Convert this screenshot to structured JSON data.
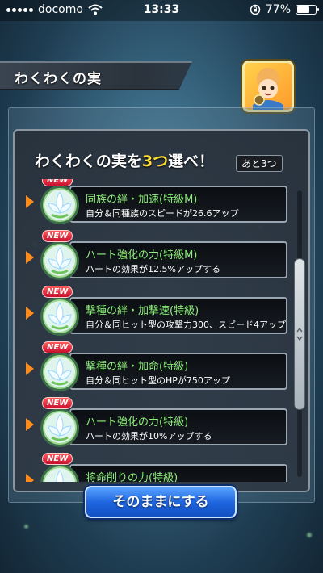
{
  "status_bar": {
    "carrier": "docomo",
    "time": "13:33",
    "battery_percent": "77%",
    "battery_level": 0.77,
    "icons": [
      "signal-icon",
      "wifi-icon",
      "rotation-lock-icon",
      "battery-icon"
    ]
  },
  "header": {
    "title": "わくわくの実"
  },
  "prompt": {
    "text_before": "わくわくの実を",
    "count": "3つ",
    "text_after": "選べ！",
    "remaining": "あと3つ"
  },
  "items": [
    {
      "badge": "NEW",
      "title": "同族の絆・加速(特級M)",
      "description": "自分＆同種族のスピードが26.6アップ"
    },
    {
      "badge": "NEW",
      "title": "ハート強化の力(特級M)",
      "description": "ハートの効果が12.5%アップする"
    },
    {
      "badge": "NEW",
      "title": "撃種の絆・加撃速(特級)",
      "description": "自分＆同ヒット型の攻撃力300、スピード4アップ"
    },
    {
      "badge": "NEW",
      "title": "撃種の絆・加命(特級)",
      "description": "自分＆同ヒット型のHPが750アップ"
    },
    {
      "badge": "NEW",
      "title": "ハート強化の力(特級)",
      "description": "ハートの効果が10%アップする"
    },
    {
      "badge": "NEW",
      "title": "将命削りの力(特級)",
      "description": ""
    }
  ],
  "buttons": {
    "keep": "そのままにする"
  },
  "colors": {
    "accent_yellow": "#ffe035",
    "item_title_green": "#8ef07a",
    "button_blue": "#1f66e0",
    "new_badge_red": "#c8102e"
  }
}
